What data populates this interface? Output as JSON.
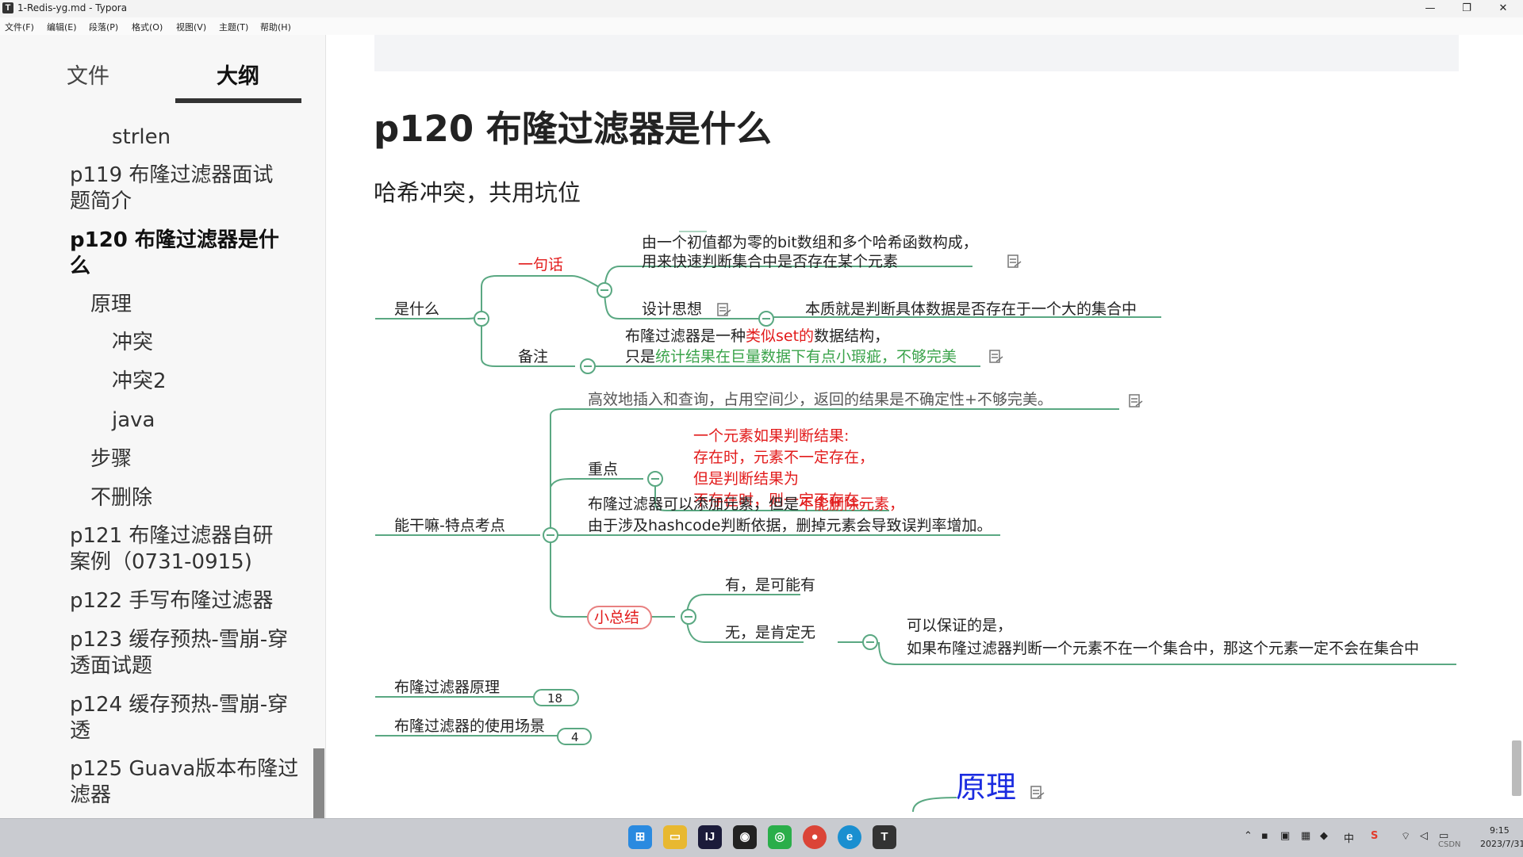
{
  "window": {
    "app_icon_letter": "T",
    "title": "1-Redis-yg.md - Typora",
    "controls": {
      "minimize": "—",
      "maximize": "❐",
      "close": "✕"
    }
  },
  "menu": [
    "文件(F)",
    "编辑(E)",
    "段落(P)",
    "格式(O)",
    "视图(V)",
    "主题(T)",
    "帮助(H)"
  ],
  "sidebar": {
    "tabs": {
      "files": "文件",
      "outline": "大纲",
      "active": "outline"
    },
    "outline": [
      {
        "label": "strlen"
      },
      {
        "label": "p119 布隆过滤器面试题简介"
      },
      {
        "label": "p120 布隆过滤器是什么",
        "active": true
      },
      {
        "label": "原理"
      },
      {
        "label": "冲突"
      },
      {
        "label": "冲突2"
      },
      {
        "label": "java"
      },
      {
        "label": "步骤"
      },
      {
        "label": "不删除"
      },
      {
        "label": "p121 布隆过滤器自研案例（0731-0915)"
      },
      {
        "label": "p122 手写布隆过滤器"
      },
      {
        "label": "p123 缓存预热-雪崩-穿透面试题"
      },
      {
        "label": "p124 缓存预热-雪崩-穿透"
      },
      {
        "label": "p125 Guava版本布隆过滤器"
      }
    ]
  },
  "document": {
    "heading": "p120 布隆过滤器是什么",
    "subheading": "哈希冲突，共用坑位",
    "mindmap": {
      "colors": {
        "branch": "#5aa882",
        "highlight_red": "#e21b1b",
        "highlight_green": "#3aa34a",
        "text": "#222222",
        "link_blue": "#1b2ce0"
      },
      "n_what": "是什么",
      "n_one_sentence": "一句话",
      "n_def_1": "由一个初值都为零的bit数组和多个哈希函数构成，",
      "n_def_2": "用来快速判断集合中是否存在某个元素",
      "n_design": "设计思想",
      "n_design_text": "本质就是判断具体数据是否存在于一个大的集合中",
      "n_note": "备注",
      "n_note_1a": "布隆过滤器是一种",
      "n_note_1b": "类似set的",
      "n_note_1c": "数据结构，",
      "n_note_2a": "只是",
      "n_note_2b": "统计结果在巨量数据下有点小瑕疵，不够完美",
      "n_features": "能干嘛-特点考点",
      "n_efficient": "高效地插入和查询，占用空间少，返回的结果是不确定性+不够完美。",
      "n_key": "重点",
      "n_key_1": "一个元素如果判断结果:",
      "n_key_2": "存在时，元素不一定存在，",
      "n_key_3": "但是判断结果为",
      "n_key_4": "不存在时，则一定不存在。",
      "n_add_1a": "布隆过滤器可以添加元素，但是",
      "n_add_1b": "不能删除元素，",
      "n_add_2": "由于涉及hashcode判断依据，删掉元素会导致误判率增加。",
      "n_summary": "小总结",
      "n_has": "有，是可能有",
      "n_none": "无，是肯定无",
      "n_guarantee_1": "可以保证的是，",
      "n_guarantee_2": "如果布隆过滤器判断一个元素不在一个集合中，那这个元素一定不会在集合中",
      "n_principle": "布隆过滤器原理",
      "n_principle_count": "18",
      "n_scenarios": "布隆过滤器的使用场景",
      "n_scenarios_count": "4",
      "n_section_principle": "原理"
    }
  },
  "taskbar": {
    "apps": [
      "start-icon",
      "file-explorer-icon",
      "intellij-icon",
      "qq-icon",
      "wechat-icon",
      "chrome-icon",
      "edge-icon",
      "typora-icon"
    ],
    "tray": {
      "ime": "中",
      "time": "9:15",
      "date": "2023/7/31",
      "watermark": "CSDN"
    }
  }
}
